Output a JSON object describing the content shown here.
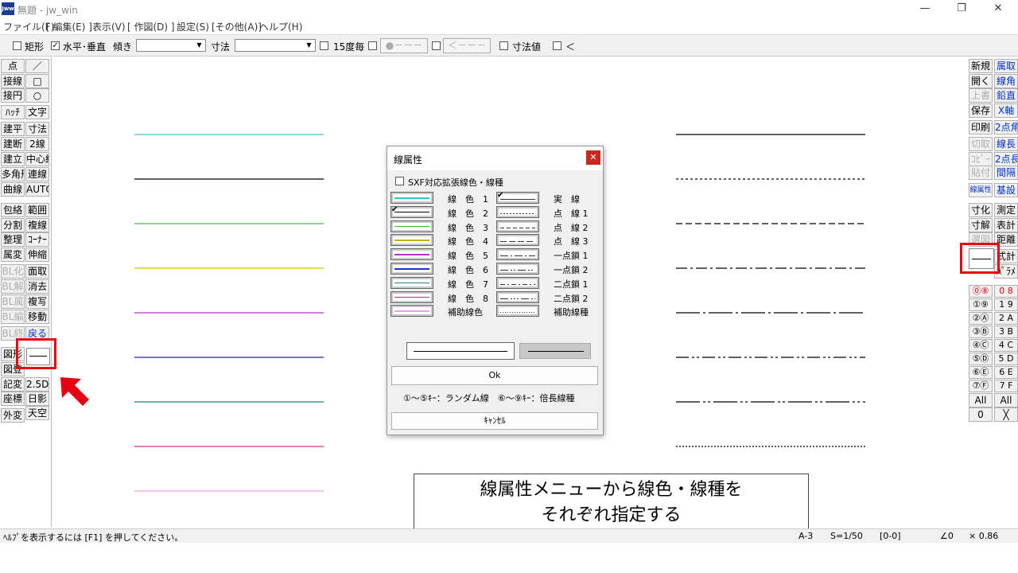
{
  "window": {
    "title": "無題 - jw_win",
    "logo_text": "Jww",
    "controls": [
      "—",
      "❐",
      "✕"
    ]
  },
  "menubar": [
    "ファイル(F)",
    "[ 編集(E) ]",
    "表示(V)",
    "[ 作図(D) ]",
    "設定(S)",
    "[その他(A)]",
    "ヘルプ(H)"
  ],
  "toolbar": {
    "rect_label": "矩形",
    "hv_label": "水平･垂直",
    "hv_checked": "✓",
    "slope_label": "傾き",
    "dim_label": "寸法",
    "deg15_label": "15度毎",
    "circle_btn": "●－－－",
    "arrow_btn": "＜－－－",
    "dimval_label": "寸法値",
    "lt_label": "＜"
  },
  "left_tools": {
    "col1": [
      "点",
      "接線",
      "接円",
      "ﾊｯﾁ",
      "建平",
      "建断",
      "建立",
      "多角形",
      "曲線",
      "包絡",
      "分割",
      "整理",
      "属変",
      "BL化",
      "BL解",
      "BL属",
      "BL編",
      "BL終",
      "図形",
      "図登",
      "記変",
      "座標",
      "外変"
    ],
    "col2": [
      "／",
      "□",
      "○",
      "文字",
      "寸法",
      "2線",
      "中心線",
      "連線",
      "AUTO",
      "範囲",
      "複線",
      "ｺｰﾅｰ",
      "伸縮",
      "面取",
      "消去",
      "複写",
      "移動",
      "戻る",
      "",
      "2.5D",
      "日影",
      "天空"
    ]
  },
  "right_tools": {
    "col1": [
      "新規",
      "開く",
      "上書",
      "保存",
      "印刷",
      "切取",
      "ｺﾋﾟｰ",
      "貼付",
      "線属性",
      "寸化",
      "寸解",
      "選図"
    ],
    "col2": [
      "属取",
      "線角",
      "鉛直",
      "X軸",
      "2点角",
      "線長",
      "2点長",
      "間隔",
      "基設",
      "測定",
      "表計",
      "距離",
      "式計",
      "ﾊﾟﾗﾒ"
    ],
    "layers_left": [
      "⓪⑧",
      "①⑨",
      "②Ⓐ",
      "③Ⓑ",
      "④Ⓒ",
      "⑤Ⓓ",
      "⑥Ⓔ",
      "⑦Ⓕ"
    ],
    "layers_right": [
      "0 8",
      "1 9",
      "2 A",
      "3 B",
      "4 C",
      "5 D",
      "6 E",
      "7 F"
    ],
    "all_left": "All",
    "all_right": "All",
    "zero_left": "0",
    "x_right": "╳"
  },
  "canvas_lines": {
    "left_colors": [
      "#40c8c0",
      "#000000",
      "#40c040",
      "#d0c000",
      "#c030d0",
      "#2020a0",
      "#208080",
      "#e03080",
      "#f0a0e0"
    ]
  },
  "dialog": {
    "title": "線属性",
    "close": "✕",
    "sxf_label": "SXF対応拡張線色・線種",
    "colors": [
      {
        "label": "線　色　1",
        "color": "#30c8d0"
      },
      {
        "label": "線　色　2",
        "color": "#000000"
      },
      {
        "label": "線　色　3",
        "color": "#30c030"
      },
      {
        "label": "線　色　4",
        "color": "#c8b400"
      },
      {
        "label": "線　色　5",
        "color": "#c030d0"
      },
      {
        "label": "線　色　6",
        "color": "#2030e0"
      },
      {
        "label": "線　色　7",
        "color": "#208888"
      },
      {
        "label": "線　色　8",
        "color": "#e02090"
      },
      {
        "label": "補助線色",
        "color": "#f0a0f0"
      }
    ],
    "types": [
      "実　線",
      "点　線 1",
      "点　線 2",
      "点　線 3",
      "一点鎖 1",
      "一点鎖 2",
      "二点鎖 1",
      "二点鎖 2",
      "補助線種"
    ],
    "ok": "Ok",
    "hint": "①～⑤ｷｰ：ランダム線　⑥～⑨ｷｰ：倍長線種",
    "cancel": "ｷｬﾝｾﾙ"
  },
  "statusbar": {
    "help": "ﾍﾙﾌﾟを表示するには [F1] を押してください。",
    "paper": "A-3",
    "scale": "S=1/50",
    "layer": "[0-0]",
    "angle": "∠0",
    "zoom": "× 0.86"
  },
  "note": {
    "line1": "線属性メニューから線色・線種を",
    "line2": "それぞれ指定する"
  },
  "accent": "#e60012"
}
